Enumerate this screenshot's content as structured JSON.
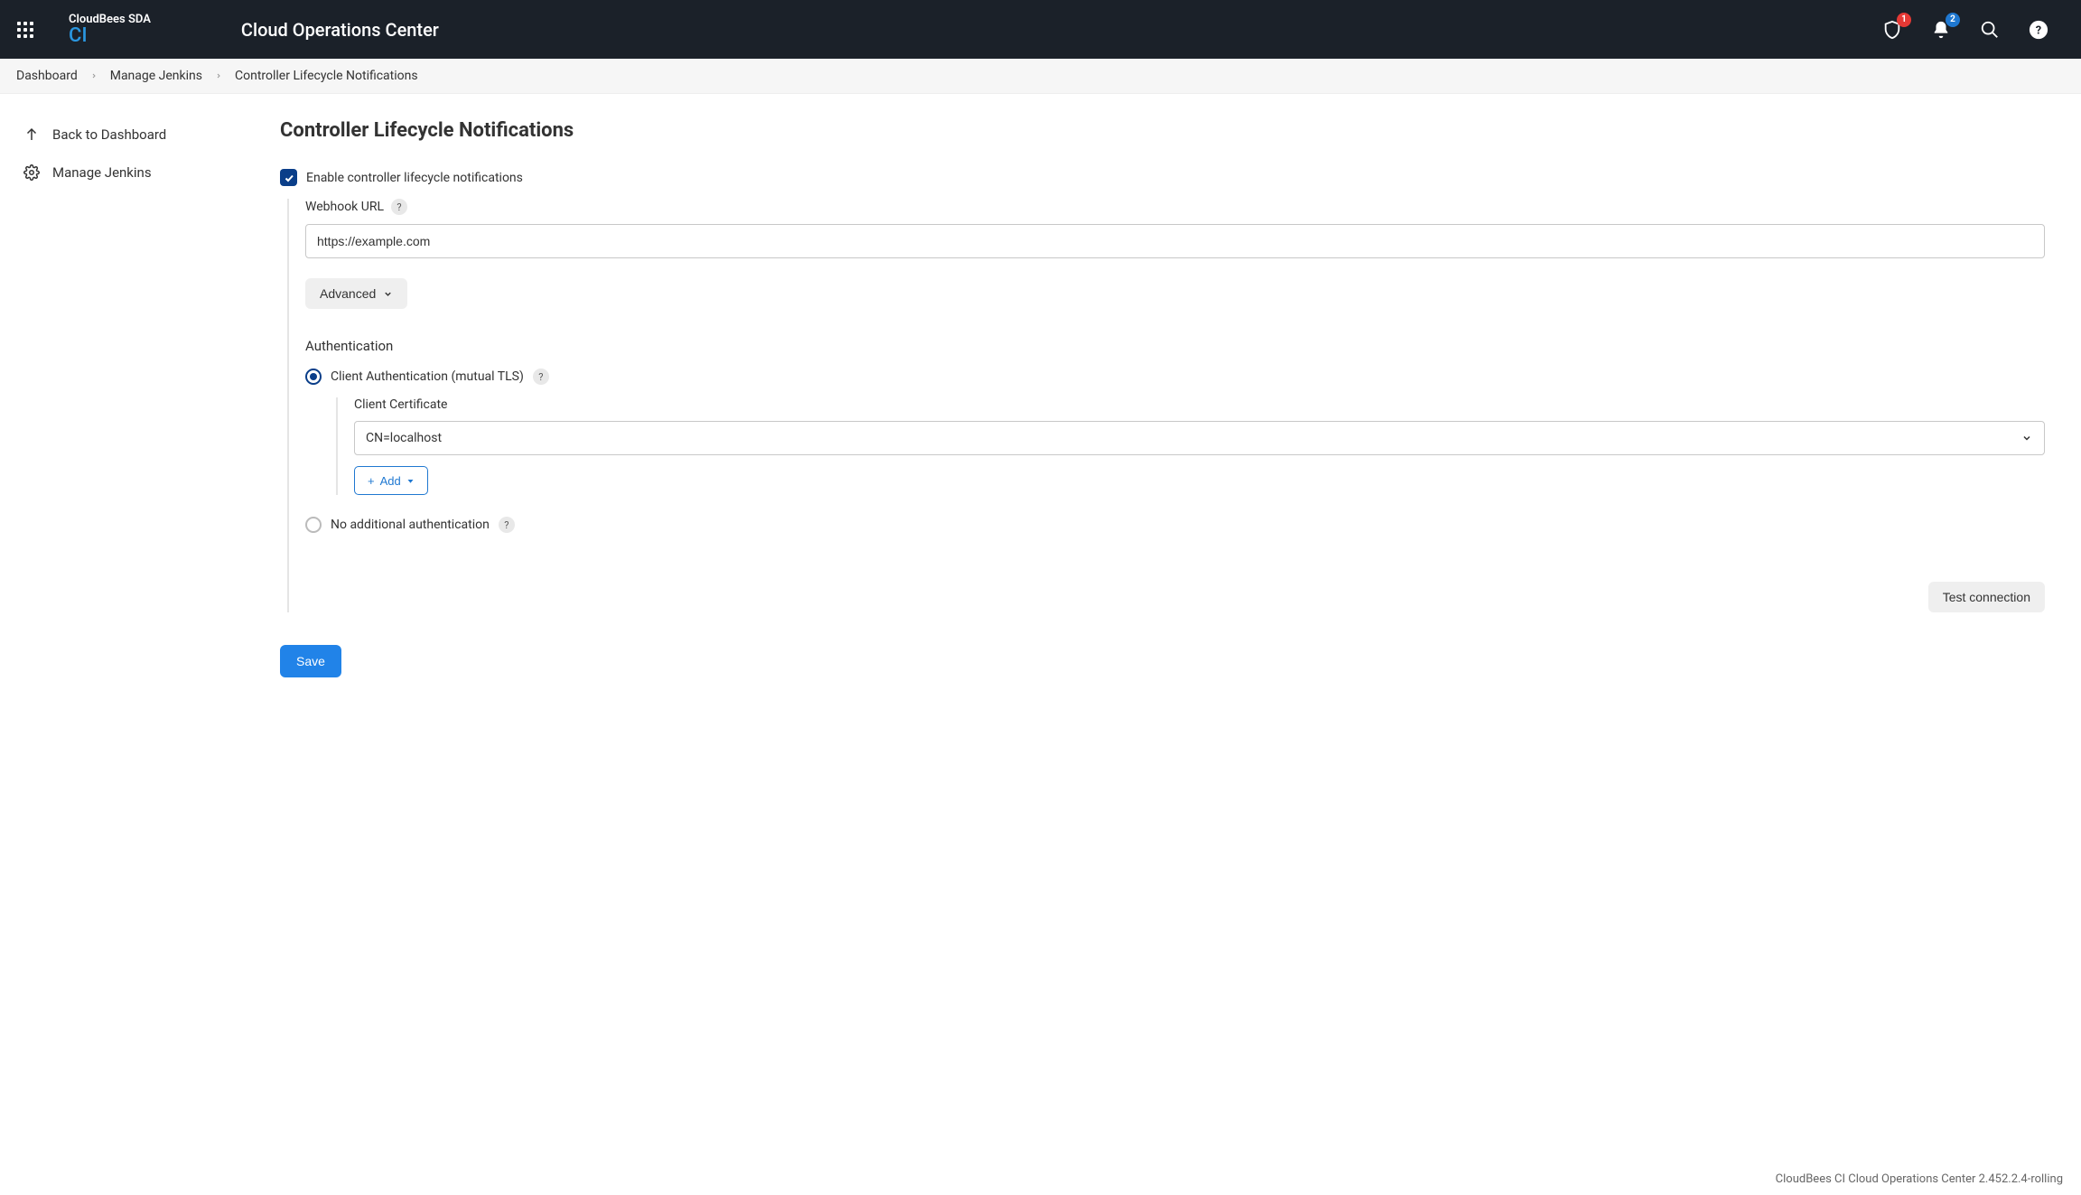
{
  "header": {
    "brand_top": "CloudBees SDA",
    "brand_bottom": "CI",
    "title": "Cloud Operations Center",
    "shield_badge": "1",
    "bell_badge": "2"
  },
  "breadcrumb": {
    "items": [
      "Dashboard",
      "Manage Jenkins",
      "Controller Lifecycle Notifications"
    ]
  },
  "sidebar": {
    "back_label": "Back to Dashboard",
    "manage_label": "Manage Jenkins"
  },
  "page": {
    "title": "Controller Lifecycle Notifications",
    "enable_label": "Enable controller lifecycle notifications",
    "webhook_label": "Webhook URL",
    "webhook_value": "https://example.com",
    "advanced_label": "Advanced",
    "auth_section_label": "Authentication",
    "auth_options": {
      "mutual_tls_label": "Client Authentication (mutual TLS)",
      "no_auth_label": "No additional authentication"
    },
    "client_cert_label": "Client Certificate",
    "client_cert_value": "CN=localhost",
    "add_button_label": "Add",
    "test_button_label": "Test connection",
    "save_button_label": "Save"
  },
  "footer": {
    "text": "CloudBees CI Cloud Operations Center 2.452.2.4-rolling"
  }
}
